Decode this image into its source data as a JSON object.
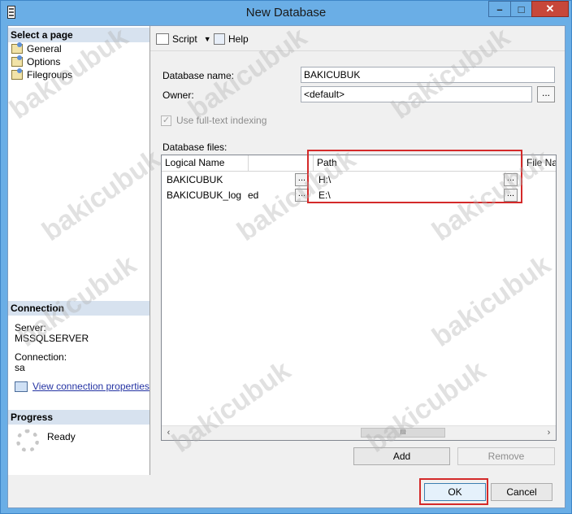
{
  "window": {
    "title": "New Database",
    "controls": [
      "minimize",
      "maximize",
      "close"
    ]
  },
  "left_pane": {
    "select_page_header": "Select a page",
    "pages": [
      "General",
      "Options",
      "Filegroups"
    ],
    "connection_header": "Connection",
    "server_label": "Server:",
    "server_value": "MSSQLSERVER",
    "connection_label": "Connection:",
    "connection_value": "sa",
    "view_properties_link": "View connection properties",
    "progress_header": "Progress",
    "progress_status": "Ready"
  },
  "toolbar": {
    "script_label": "Script",
    "help_label": "Help"
  },
  "general": {
    "database_name_label": "Database name:",
    "database_name_value": "BAKICUBUK",
    "owner_label": "Owner:",
    "owner_value": "<default>",
    "browse_label": "...",
    "fulltext_label": "Use full-text indexing",
    "fulltext_checked": true,
    "database_files_label": "Database files:"
  },
  "files_grid": {
    "columns": [
      "Logical Name",
      "",
      "Path",
      "File Nam"
    ],
    "rows": [
      {
        "logical_name": "BAKICUBUK",
        "partial": "",
        "path": "H:\\"
      },
      {
        "logical_name": "BAKICUBUK_log",
        "partial": "ed",
        "path": "E:\\"
      }
    ],
    "scroll_thumb_glyph": "III"
  },
  "buttons": {
    "add": "Add",
    "remove": "Remove",
    "ok": "OK",
    "cancel": "Cancel"
  },
  "watermark": "bakicubuk",
  "colors": {
    "highlight_border": "#d42a2a",
    "link": "#2433a3",
    "title_bar": "#6aaee6"
  }
}
